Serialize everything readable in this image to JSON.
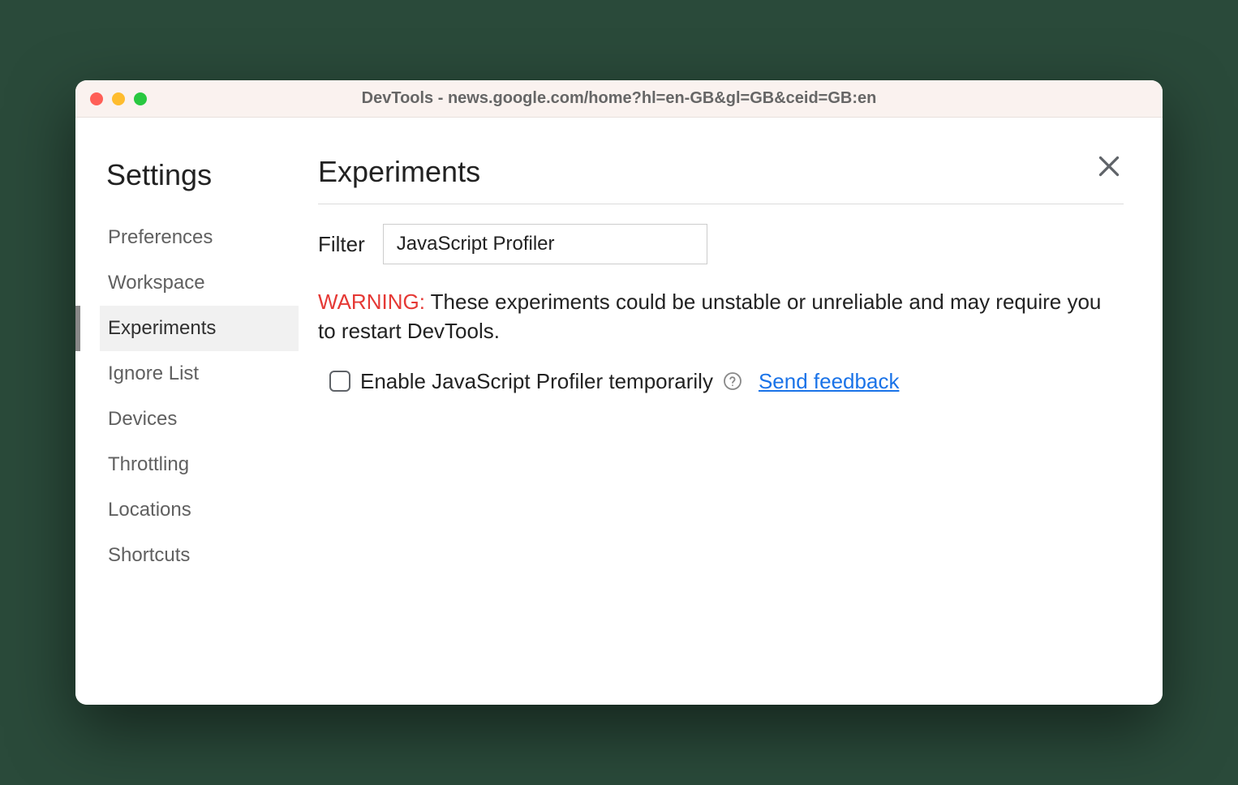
{
  "window": {
    "title": "DevTools - news.google.com/home?hl=en-GB&gl=GB&ceid=GB:en"
  },
  "sidebar": {
    "title": "Settings",
    "items": [
      {
        "label": "Preferences",
        "active": false
      },
      {
        "label": "Workspace",
        "active": false
      },
      {
        "label": "Experiments",
        "active": true
      },
      {
        "label": "Ignore List",
        "active": false
      },
      {
        "label": "Devices",
        "active": false
      },
      {
        "label": "Throttling",
        "active": false
      },
      {
        "label": "Locations",
        "active": false
      },
      {
        "label": "Shortcuts",
        "active": false
      }
    ]
  },
  "main": {
    "title": "Experiments",
    "filter_label": "Filter",
    "filter_value": "JavaScript Profiler",
    "warning_prefix": "WARNING:",
    "warning_text": " These experiments could be unstable or unreliable and may require you to restart DevTools.",
    "option_label": "Enable JavaScript Profiler temporarily",
    "feedback_label": "Send feedback"
  }
}
